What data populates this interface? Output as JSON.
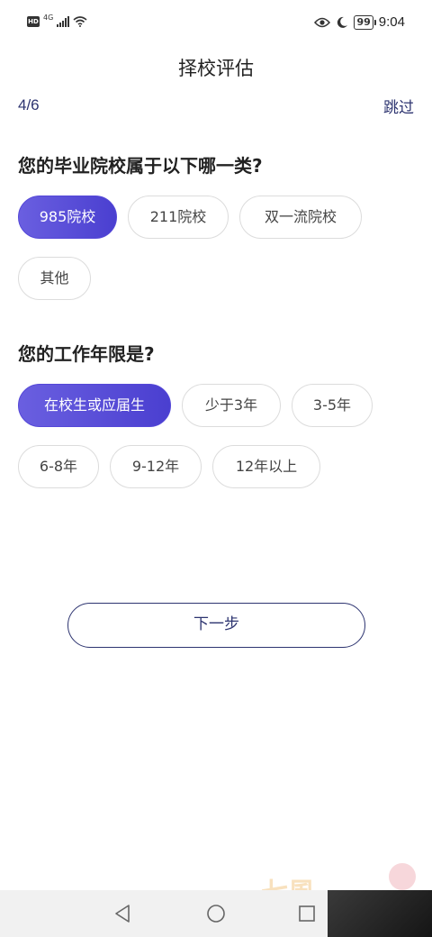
{
  "status_bar": {
    "hd": "HD",
    "network": "4G",
    "battery": "99",
    "time": "9:04"
  },
  "header": {
    "title": "择校评估"
  },
  "progress": {
    "current": "4/6",
    "skip_label": "跳过"
  },
  "question_1": {
    "text": "您的毕业院校属于以下哪一类?",
    "options": [
      "985院校",
      "211院校",
      "双一流院校",
      "其他"
    ],
    "selected": "985院校"
  },
  "question_2": {
    "text": "您的工作年限是?",
    "options": [
      "在校生或应届生",
      "少于3年",
      "3-5年",
      "6-8年",
      "9-12年",
      "12年以上"
    ],
    "selected": "在校生或应届生"
  },
  "next_button": {
    "label": "下一步"
  },
  "watermark": {
    "text": "七風"
  },
  "colors": {
    "accent": "#5548d8",
    "navy": "#2d3470",
    "chip_border": "#dcdcdc"
  },
  "icons": [
    "signal-icon",
    "wifi-icon",
    "eye-icon",
    "moon-icon",
    "back-icon",
    "home-icon",
    "recent-apps-icon"
  ]
}
